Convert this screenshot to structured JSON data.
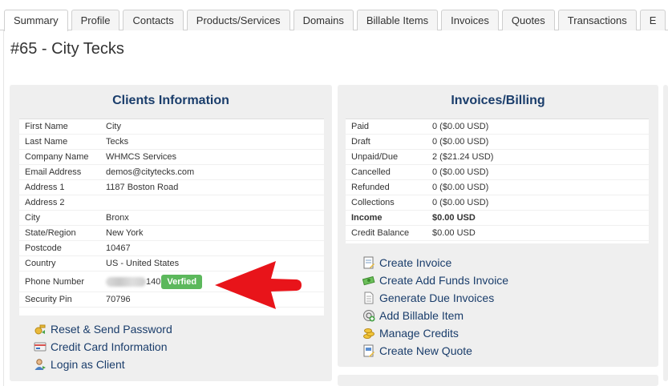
{
  "tabs": [
    "Summary",
    "Profile",
    "Contacts",
    "Products/Services",
    "Domains",
    "Billable Items",
    "Invoices",
    "Quotes",
    "Transactions",
    "E"
  ],
  "page_title": "#65 - City Tecks",
  "client_info": {
    "title": "Clients Information",
    "rows": [
      {
        "label": "First Name",
        "value": "City"
      },
      {
        "label": "Last Name",
        "value": "Tecks"
      },
      {
        "label": "Company Name",
        "value": "WHMCS Services"
      },
      {
        "label": "Email Address",
        "value": "demos@citytecks.com"
      },
      {
        "label": "Address 1",
        "value": "1187 Boston Road"
      },
      {
        "label": "Address 2",
        "value": ""
      },
      {
        "label": "City",
        "value": "Bronx"
      },
      {
        "label": "State/Region",
        "value": "New York"
      },
      {
        "label": "Postcode",
        "value": "10467"
      },
      {
        "label": "Country",
        "value": "US - United States"
      }
    ],
    "phone": {
      "label": "Phone Number",
      "value_suffix": "140",
      "badge": "Verfied"
    },
    "security": {
      "label": "Security Pin",
      "value": "70796"
    },
    "links": [
      "Reset & Send Password",
      "Credit Card Information",
      "Login as Client"
    ]
  },
  "billing": {
    "title": "Invoices/Billing",
    "rows": [
      {
        "label": "Paid",
        "value": "0 ($0.00 USD)"
      },
      {
        "label": "Draft",
        "value": "0 ($0.00 USD)"
      },
      {
        "label": "Unpaid/Due",
        "value": "2 ($21.24 USD)"
      },
      {
        "label": "Cancelled",
        "value": "0 ($0.00 USD)"
      },
      {
        "label": "Refunded",
        "value": "0 ($0.00 USD)"
      },
      {
        "label": "Collections",
        "value": "0 ($0.00 USD)"
      },
      {
        "label": "Income",
        "value": "$0.00 USD"
      },
      {
        "label": "Credit Balance",
        "value": "$0.00 USD"
      }
    ],
    "links": [
      "Create Invoice",
      "Create Add Funds Invoice",
      "Generate Due Invoices",
      "Add Billable Item",
      "Manage Credits",
      "Create New Quote"
    ]
  },
  "colors": {
    "heading": "#1a3d6b",
    "panel": "#efefef",
    "verified": "#5cb85c",
    "arrow": "#e8141a"
  },
  "icons": [
    "key-refresh-icon",
    "credit-card-icon",
    "user-login-icon",
    "invoice-icon",
    "money-icon",
    "document-icon",
    "add-item-icon",
    "coins-icon",
    "quote-icon"
  ]
}
